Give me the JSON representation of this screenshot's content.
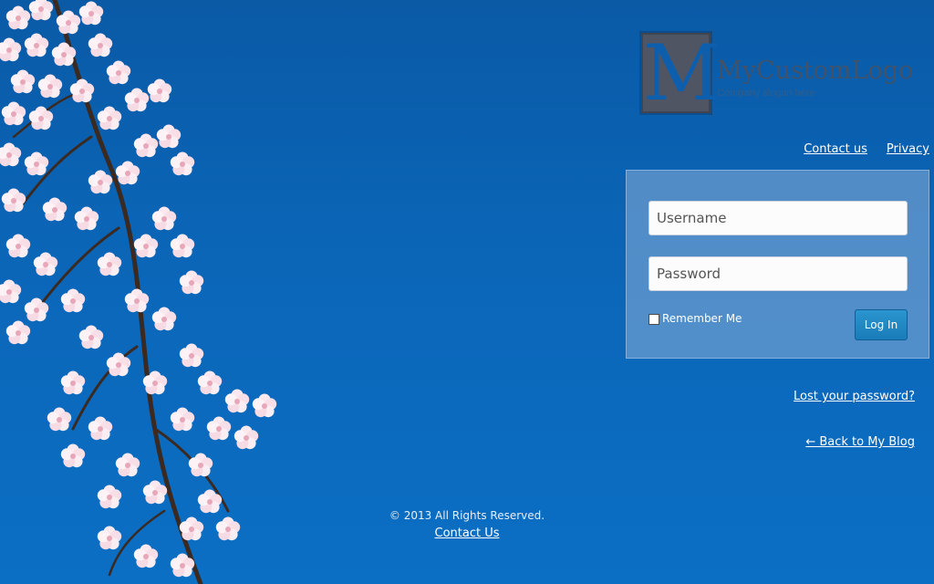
{
  "logo": {
    "letter": "M",
    "name": "MyCustomLogo",
    "tagline": "Company slogan here"
  },
  "top_links": {
    "contact": "Contact us",
    "privacy": "Privacy"
  },
  "login": {
    "username_placeholder": "Username",
    "password_placeholder": "Password",
    "remember_label": "Remember Me",
    "remember_checked": false,
    "button_label": "Log In"
  },
  "links": {
    "lost_password": "Lost your password?",
    "back_to_blog": "← Back to My Blog"
  },
  "footer": {
    "copyright": "© 2013 All Rights Reserved.",
    "contact": "Contact Us"
  },
  "colors": {
    "background": "#0b66b8",
    "panel": "#8cafd7",
    "button": "#1f86c2",
    "logo_mark": "#4f5563"
  }
}
